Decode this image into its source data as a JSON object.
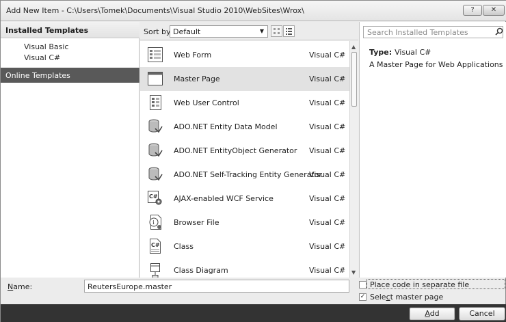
{
  "window": {
    "title": "Add New Item - C:\\Users\\Tomek\\Documents\\Visual Studio 2010\\WebSites\\Wrox\\",
    "help_label": "?",
    "close_label": "✕"
  },
  "left_pane": {
    "installed_header": "Installed Templates",
    "tree": [
      {
        "label": "Visual Basic"
      },
      {
        "label": "Visual C#"
      }
    ],
    "online_label": "Online Templates"
  },
  "toolbar": {
    "sort_label": "Sort by:",
    "sort_value": "Default"
  },
  "templates": [
    {
      "name": "Web Form",
      "lang": "Visual C#",
      "icon": "web-form-icon"
    },
    {
      "name": "Master Page",
      "lang": "Visual C#",
      "icon": "master-page-icon",
      "selected": true
    },
    {
      "name": "Web User Control",
      "lang": "Visual C#",
      "icon": "user-control-icon"
    },
    {
      "name": "ADO.NET Entity Data Model",
      "lang": "Visual C#",
      "icon": "database-icon"
    },
    {
      "name": "ADO.NET EntityObject Generator",
      "lang": "Visual C#",
      "icon": "database-icon"
    },
    {
      "name": "ADO.NET Self-Tracking Entity Generator",
      "lang": "Visual C#",
      "icon": "database-icon"
    },
    {
      "name": "AJAX-enabled WCF Service",
      "lang": "Visual C#",
      "icon": "wcf-service-icon"
    },
    {
      "name": "Browser File",
      "lang": "Visual C#",
      "icon": "browser-file-icon"
    },
    {
      "name": "Class",
      "lang": "Visual C#",
      "icon": "class-icon"
    },
    {
      "name": "Class Diagram",
      "lang": "Visual C#",
      "icon": "class-diagram-icon"
    }
  ],
  "right_pane": {
    "search_placeholder": "Search Installed Templates",
    "type_label": "Type:",
    "type_value": "Visual C#",
    "description": "A Master Page for Web Applications"
  },
  "bottom": {
    "name_label_pre": "",
    "name_label_key": "N",
    "name_label_post": "ame:",
    "name_value": "ReutersEurope.master",
    "place_code_label": "Place code in separate file",
    "place_code_checked": false,
    "select_master_pre": "Sele",
    "select_master_key": "c",
    "select_master_post": "t master page",
    "select_master_checked": true,
    "add_key": "A",
    "add_post": "dd",
    "cancel_label": "Cancel"
  }
}
